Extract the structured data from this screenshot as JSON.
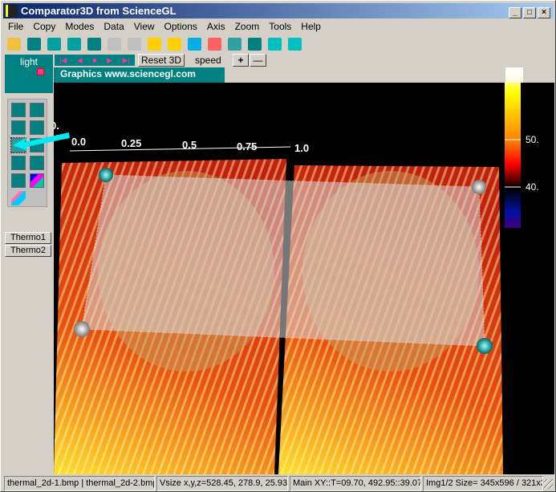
{
  "window": {
    "title": "Comparator3D from ScienceGL",
    "min": "_",
    "max": "□",
    "close": "×"
  },
  "menu": [
    "File",
    "Copy",
    "Modes",
    "Data",
    "View",
    "Options",
    "Axis",
    "Zoom",
    "Tools",
    "Help"
  ],
  "toolbar": [
    "open-icon",
    "save-icon",
    "print-icon",
    "sphere-icon",
    "camera-icon",
    "zoom-in-icon",
    "zoom-out-icon",
    "light-icon",
    "spotlight-icon",
    "sparkle-icon",
    "palette-up-icon",
    "palette-up2-icon",
    "profile-icon",
    "plane-points-icon",
    "screw-icon"
  ],
  "toolbarColors": [
    "#f0c040",
    "#008080",
    "#00a0a0",
    "#00a0a0",
    "#008080",
    "#c0c0c0",
    "#c0c0c0",
    "#ffd000",
    "#ffd000",
    "#00b0e0",
    "#ff6060",
    "#30a0a0",
    "#008080",
    "#00c0c0",
    "#00c0c0"
  ],
  "light": {
    "label": "light",
    "color": "#ff3399"
  },
  "controls": {
    "reset": "Reset 3D",
    "speed": "speed",
    "plus": "+",
    "minus": "—"
  },
  "graphics_label": "Graphics www.sciencegl.com",
  "side_buttons": [
    "Thermo1",
    "Thermo2"
  ],
  "axis_ticks": [
    "0.0",
    "0.25",
    "0.5",
    "0.75",
    "1.0"
  ],
  "axis_corner": "0.",
  "colorbar": {
    "labels": [
      "50.",
      "40."
    ]
  },
  "status": [
    "thermal_2d-1.bmp | thermal_2d-2.bmp",
    "Vsize x,y,z=528.45, 278.9, 25.93",
    "Main XY::T=09.70, 492.95::39.07",
    "Img1/2 Size= 345x596 / 321x3"
  ]
}
